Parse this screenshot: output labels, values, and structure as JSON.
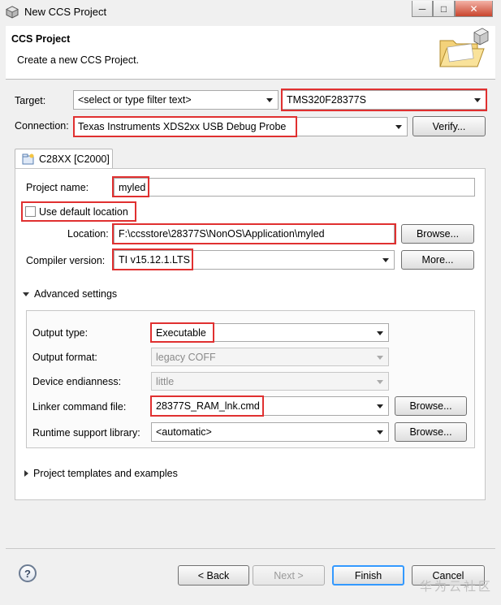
{
  "window": {
    "title": "New CCS Project",
    "controls": {
      "minimize": "─",
      "maximize": "□",
      "close": "✕"
    }
  },
  "banner": {
    "title": "CCS Project",
    "description": "Create a new CCS Project."
  },
  "target": {
    "label": "Target:",
    "filter_value": "<select or type filter text>",
    "device_value": "TMS320F28377S"
  },
  "connection": {
    "label": "Connection:",
    "value": "Texas Instruments XDS2xx USB Debug Probe",
    "verify_label": "Verify..."
  },
  "tab": {
    "label": "C28XX [C2000]"
  },
  "project": {
    "name_label": "Project name:",
    "name_value": "myled",
    "use_default_label": "Use default location",
    "use_default_checked": false,
    "location_label": "Location:",
    "location_value": "F:\\ccsstore\\28377S\\NonOS\\Application\\myled",
    "browse_label": "Browse...",
    "compiler_label": "Compiler version:",
    "compiler_value": "TI v15.12.1.LTS",
    "more_label": "More..."
  },
  "advanced": {
    "header": "Advanced settings",
    "output_type_label": "Output type:",
    "output_type_value": "Executable",
    "output_format_label": "Output format:",
    "output_format_value": "legacy COFF",
    "endianness_label": "Device endianness:",
    "endianness_value": "little",
    "linker_label": "Linker command file:",
    "linker_value": "28377S_RAM_lnk.cmd",
    "linker_browse": "Browse...",
    "runtime_label": "Runtime support library:",
    "runtime_value": "<automatic>",
    "runtime_browse": "Browse..."
  },
  "templates": {
    "header": "Project templates and examples"
  },
  "footer": {
    "help": "?",
    "back_label": "< Back",
    "next_label": "Next >",
    "finish_label": "Finish",
    "cancel_label": "Cancel"
  },
  "watermark": "华为云社区",
  "colors": {
    "highlight": "#e03030",
    "accent": "#3399ff"
  }
}
